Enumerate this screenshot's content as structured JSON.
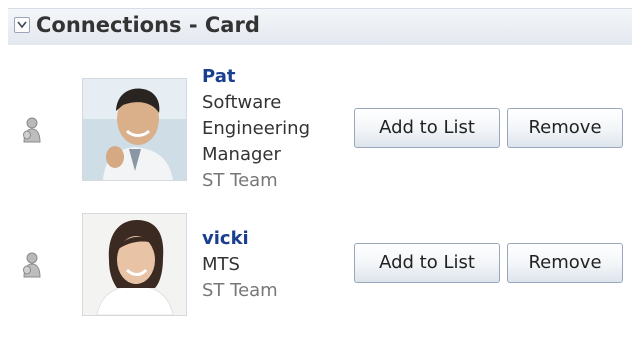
{
  "panel": {
    "title": "Connections - Card",
    "disclosure_icon": "chevron-down-icon"
  },
  "connections": [
    {
      "name": "Pat",
      "title_lines": [
        "Software",
        "Engineering",
        "Manager"
      ],
      "team": "ST Team",
      "presence_icon": "presence-offline-icon",
      "add_label": "Add to List",
      "remove_label": "Remove"
    },
    {
      "name": "vicki",
      "title_lines": [
        "MTS"
      ],
      "team": "ST Team",
      "presence_icon": "presence-offline-icon",
      "add_label": "Add to List",
      "remove_label": "Remove"
    }
  ],
  "colors": {
    "name_link": "#1b3f8f",
    "header_bg": "#e3e8ef",
    "button_border": "#98a7bb"
  }
}
